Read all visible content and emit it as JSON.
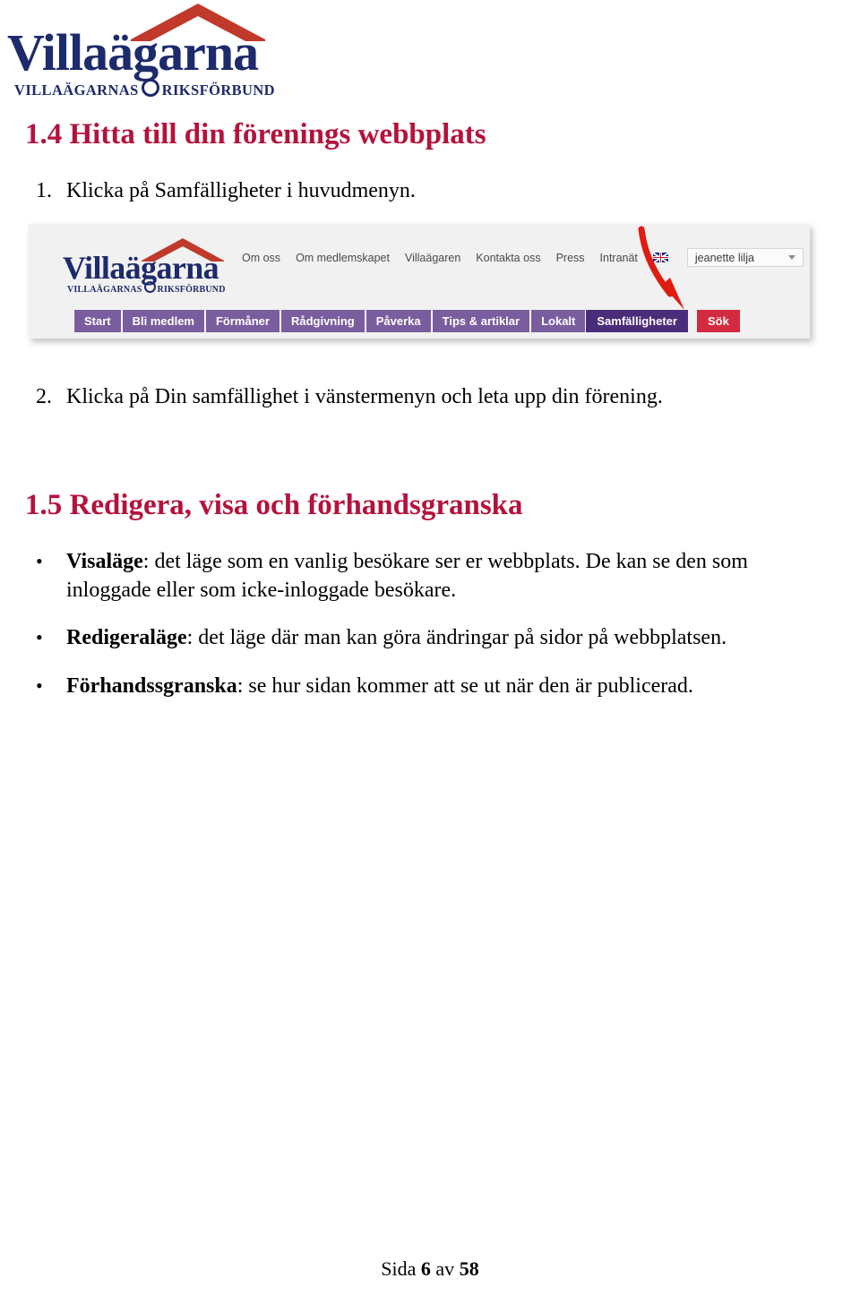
{
  "document": {
    "brand": {
      "name": "Villaägarna",
      "tagline_left": "VILLAÄGARNAS",
      "tagline_right": "RIKSFÖRBUND",
      "logo_navy": "#1d2a6b",
      "logo_red": "#c0392b"
    },
    "heading_color": "#b4123c",
    "sections": {
      "s14_heading": "1.4 Hitta till din förenings webbplats",
      "s15_heading": "1.5 Redigera, visa och förhandsgranska"
    },
    "steps": [
      {
        "num": "1.",
        "text": "Klicka på Samfälligheter i huvudmenyn."
      },
      {
        "num": "2.",
        "text": "Klicka på Din samfällighet i vänstermenyn och leta upp din förening."
      }
    ],
    "bullets": [
      {
        "marker": "•",
        "term": "Visaläge",
        "rest": ": det läge som en vanlig besökare ser er webbplats. De kan se den som inloggade eller som icke-inloggade besökare."
      },
      {
        "marker": "•",
        "term": "Redigeraläge",
        "rest": ": det läge där man kan göra ändringar på sidor på webbplatsen."
      },
      {
        "marker": "•",
        "term": "Förhandssgranska",
        "rest": ": se hur sidan kommer att se ut när den är publicerad."
      }
    ],
    "footer": {
      "prefix": "Sida ",
      "page": "6",
      "middle": " av ",
      "total": "58"
    }
  },
  "embedded_screenshot": {
    "background": "#f1f1f1",
    "top_menu": [
      "Om oss",
      "Om medlemskapet",
      "Villaägaren",
      "Kontakta oss",
      "Press",
      "Intranät"
    ],
    "language_flag": "uk-flag-icon",
    "user_menu": {
      "label": "jeanette lilja",
      "caret": "chevron-down-icon"
    },
    "main_nav": [
      {
        "label": "Start",
        "state": "normal"
      },
      {
        "label": "Bli medlem",
        "state": "normal"
      },
      {
        "label": "Förmåner",
        "state": "normal"
      },
      {
        "label": "Rådgivning",
        "state": "normal"
      },
      {
        "label": "Påverka",
        "state": "normal"
      },
      {
        "label": "Tips & artiklar",
        "state": "normal"
      },
      {
        "label": "Lokalt",
        "state": "normal"
      },
      {
        "label": "Samfälligheter",
        "state": "active"
      },
      {
        "label": "Sök",
        "state": "search"
      }
    ],
    "colors": {
      "nav_purple": "#7a5d9e",
      "nav_active_purple": "#4a2d7a",
      "search_red": "#d42a3f"
    },
    "annotation": {
      "type": "red-arrow",
      "points_to": "Samfälligheter",
      "color": "#e01b10"
    }
  }
}
